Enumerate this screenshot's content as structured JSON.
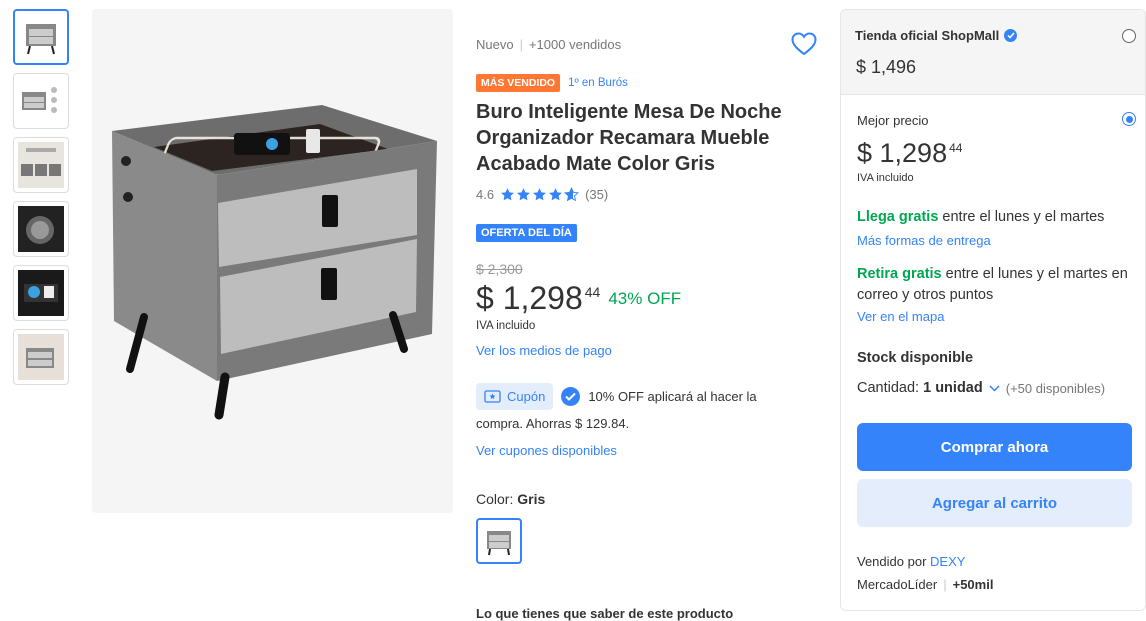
{
  "product": {
    "condition": "Nuevo",
    "sold": "+1000 vendidos",
    "best_seller_badge": "MÁS VENDIDO",
    "ranking_link": "1º en Burós",
    "title": "Buro Inteligente Mesa De Noche Organizador Recamara Mueble Acabado Mate Color Gris",
    "rating": "4.6",
    "rating_value": 4.6,
    "reviews": "(35)",
    "offer_badge": "OFERTA DEL DÍA",
    "old_price": "$ 2,300",
    "price": "$ 1,298",
    "price_cents": "44",
    "discount": "43% OFF",
    "tax_note": "IVA incluido",
    "payment_link": "Ver los medios de pago",
    "coupon_label": "Cupón",
    "coupon_text_1": "10% OFF aplicará al hacer la",
    "coupon_text_2": "compra. Ahorras $ 129.84.",
    "coupons_link": "Ver cupones disponibles",
    "color_label": "Color: ",
    "color_value": "Gris",
    "know_title": "Lo que tienes que saber de este producto"
  },
  "panel": {
    "store_name": "Tienda oficial ShopMall",
    "store_price": "$ 1,496",
    "best_label": "Mejor precio",
    "best_price": "$ 1,298",
    "best_cents": "44",
    "best_tax": "IVA incluido",
    "ship_free_label": "Llega gratis",
    "ship_free_text": " entre el lunes y el martes",
    "ship_more_link": "Más formas de entrega",
    "pickup_label": "Retira gratis",
    "pickup_text": " entre el lunes y el martes en correo y otros puntos",
    "map_link": "Ver en el mapa",
    "stock": "Stock disponible",
    "qty_label": "Cantidad: ",
    "qty_value": "1 unidad",
    "qty_available": "(+50 disponibles)",
    "buy_now": "Comprar ahora",
    "add_cart": "Agregar al carrito",
    "sold_by_label": "Vendido por ",
    "seller_name": "DEXY",
    "leader": "MercadoLíder",
    "leader_sales": "+50mil"
  },
  "colors": {
    "accent": "#3483fa",
    "green": "#00a650",
    "orange": "#ff7733"
  }
}
